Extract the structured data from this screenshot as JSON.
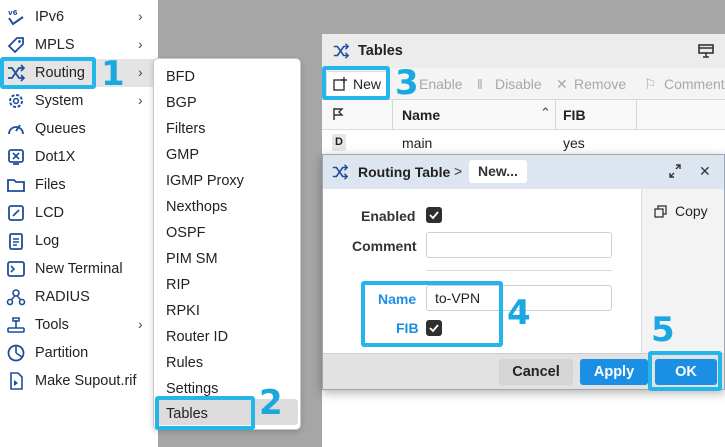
{
  "sidebar": {
    "items": [
      {
        "label": "IPv6",
        "icon": "ipv6-icon",
        "has_submenu": true
      },
      {
        "label": "MPLS",
        "icon": "tag-icon",
        "has_submenu": true
      },
      {
        "label": "Routing",
        "icon": "routing-shuffle-icon",
        "has_submenu": true
      },
      {
        "label": "System",
        "icon": "gear-icon",
        "has_submenu": true
      },
      {
        "label": "Queues",
        "icon": "gauge-icon",
        "has_submenu": false
      },
      {
        "label": "Dot1X",
        "icon": "dot1x-icon",
        "has_submenu": false
      },
      {
        "label": "Files",
        "icon": "folder-icon",
        "has_submenu": false
      },
      {
        "label": "LCD",
        "icon": "lcd-icon",
        "has_submenu": false
      },
      {
        "label": "Log",
        "icon": "log-icon",
        "has_submenu": false
      },
      {
        "label": "New Terminal",
        "icon": "terminal-icon",
        "has_submenu": false
      },
      {
        "label": "RADIUS",
        "icon": "radius-icon",
        "has_submenu": false
      },
      {
        "label": "Tools",
        "icon": "wrench-icon",
        "has_submenu": true
      },
      {
        "label": "Partition",
        "icon": "partition-icon",
        "has_submenu": false
      },
      {
        "label": "Make Supout.rif",
        "icon": "supout-icon",
        "has_submenu": false
      }
    ],
    "chevron": "›",
    "selected": "Routing"
  },
  "submenu": {
    "items": [
      "BFD",
      "BGP",
      "Filters",
      "GMP",
      "IGMP Proxy",
      "Nexthops",
      "OSPF",
      "PIM SM",
      "RIP",
      "RPKI",
      "Router ID",
      "Rules",
      "Settings",
      "Tables"
    ],
    "selected": "Tables"
  },
  "tables_window": {
    "title": "Tables",
    "toolbar": {
      "new_label": "New",
      "enable_label": "Enable",
      "disable_label": "Disable",
      "remove_label": "Remove",
      "comment_label": "Comment"
    },
    "columns": [
      "Name",
      "FIB"
    ],
    "rows": [
      {
        "flag": "D",
        "name": "main",
        "fib": "yes"
      }
    ]
  },
  "dialog": {
    "title": "Routing Table",
    "breadcrumb_sep": ">",
    "breadcrumb_current": "New...",
    "enabled_label": "Enabled",
    "enabled_checked": true,
    "comment_label": "Comment",
    "comment_value": "",
    "name_label": "Name",
    "name_value": "to-VPN",
    "fib_label": "FIB",
    "fib_checked": true,
    "copy_label": "Copy",
    "cancel_label": "Cancel",
    "apply_label": "Apply",
    "ok_label": "OK"
  },
  "annotations": {
    "step1": "1",
    "step2": "2",
    "step3": "3",
    "step4": "4",
    "step5": "5"
  },
  "colors": {
    "accent": "#1a8fe3",
    "callout": "#22b6ea",
    "desktop": "#a6a6a6",
    "dialog_title": "#dde6f0"
  }
}
